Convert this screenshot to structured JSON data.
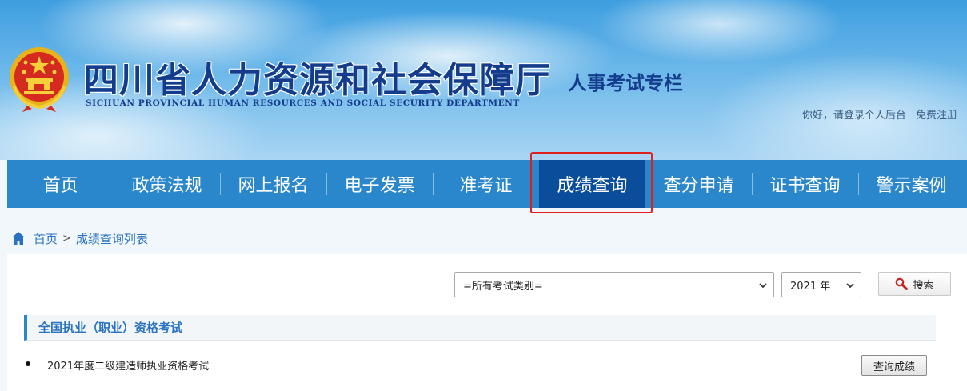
{
  "header": {
    "title_cn": "四川省人力资源和社会保障厅",
    "title_en": "SICHUAN PROVINCIAL HUMAN RESOURCES AND SOCIAL SECURITY DEPARTMENT",
    "sub_title": "人事考试专栏",
    "greeting": "你好，请登录个人后台",
    "register": "免费注册",
    "emblem_icon": "national-emblem-icon"
  },
  "nav": {
    "items": [
      {
        "label": "首页"
      },
      {
        "label": "政策法规"
      },
      {
        "label": "网上报名"
      },
      {
        "label": "电子发票"
      },
      {
        "label": "准考证"
      },
      {
        "label": "成绩查询"
      },
      {
        "label": "查分申请"
      },
      {
        "label": "证书查询"
      },
      {
        "label": "警示案例"
      }
    ],
    "active": "成绩查询",
    "active_color": "#0a4e9b",
    "bar_color": "#2a87cc",
    "highlight_color": "#e02020"
  },
  "breadcrumb": {
    "home": "首页",
    "separator": ">",
    "current": "成绩查询列表",
    "icon": "home-icon"
  },
  "filters": {
    "category_value": "=所有考试类别=",
    "year_value": "2021 年",
    "search_label": "搜索",
    "search_icon": "magnifier-icon"
  },
  "section": {
    "title": "全国执业（职业）资格考试",
    "items": [
      {
        "name": "2021年度二级建造师执业资格考试",
        "action": "查询成绩"
      }
    ]
  }
}
